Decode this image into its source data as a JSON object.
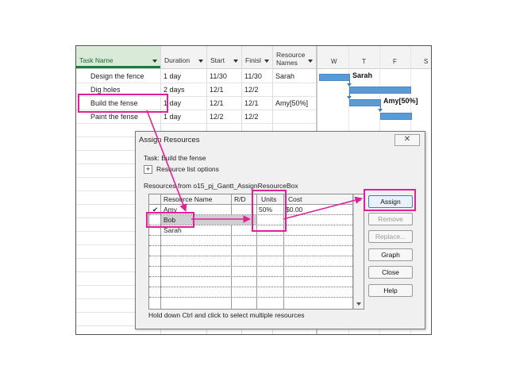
{
  "gantt": {
    "columns": {
      "task_name": "Task Name",
      "duration": "Duration",
      "start": "Start",
      "finish": "Finisl",
      "resource_names_1": "Resource",
      "resource_names_2": "Names"
    },
    "rows": [
      {
        "task": "Design the fence",
        "duration": "1 day",
        "start": "11/30",
        "finish": "11/30",
        "resources": "Sarah"
      },
      {
        "task": "Dig holes",
        "duration": "2 days",
        "start": "12/1",
        "finish": "12/2",
        "resources": ""
      },
      {
        "task": "Build the fense",
        "duration": "1 day",
        "start": "12/1",
        "finish": "12/1",
        "resources": "Amy[50%]"
      },
      {
        "task": "Paint the fense",
        "duration": "1 day",
        "start": "12/2",
        "finish": "12/2",
        "resources": ""
      }
    ],
    "timescale_days": [
      "W",
      "T",
      "F",
      "S"
    ],
    "bar_labels": {
      "sarah": "Sarah",
      "amy": "Amy[50%]"
    }
  },
  "dialog": {
    "title": "Assign Resources",
    "close_glyph": "✕",
    "task_line": "Task: Build the fense",
    "options_plus": "+",
    "options_label": "Resource list options",
    "resources_from": "Resources from o15_pj_Gantt_AssignResourceBox",
    "grid_headers": {
      "resource_name": "Resource Name",
      "rd": "R/D",
      "units": "Units",
      "cost": "Cost"
    },
    "resources": [
      {
        "check": "✔",
        "name": "Amy",
        "units": "50%",
        "cost": "$0.00"
      },
      {
        "check": "",
        "name": "Bob",
        "units": "",
        "cost": ""
      },
      {
        "check": "",
        "name": "Sarah",
        "units": "",
        "cost": ""
      }
    ],
    "buttons": {
      "assign": "Assign",
      "remove": "Remove",
      "replace": "Replace...",
      "graph": "Graph",
      "close": "Close",
      "help": "Help"
    },
    "footer": "Hold down Ctrl and click to select multiple resources"
  },
  "colors": {
    "accent_highlight": "#e0209a",
    "bar": "#5b9bd5",
    "selected_header": "#1f7a3c"
  }
}
